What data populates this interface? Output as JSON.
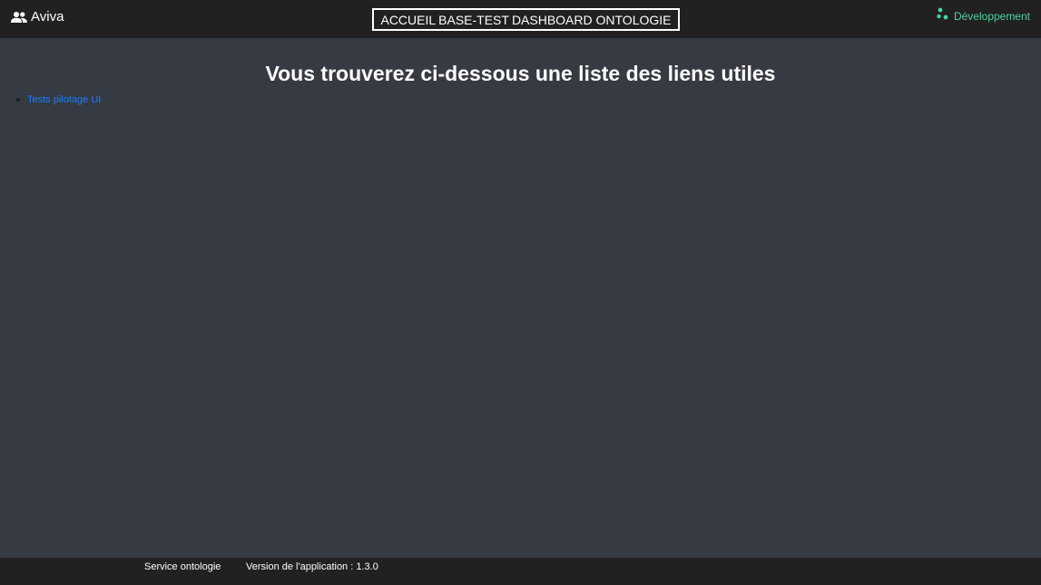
{
  "header": {
    "brand": "Aviva",
    "brand_icon": "users-icon",
    "nav": [
      {
        "label": "ACCUEIL"
      },
      {
        "label": "BASE-TEST"
      },
      {
        "label": "DASHBOARD ONTOLOGIE"
      }
    ],
    "environment": "Développement",
    "environment_icon": "cluster-dots-icon",
    "environment_color": "#4fd1a1"
  },
  "main": {
    "title": "Vous trouverez ci-dessous une liste des liens utiles",
    "links": [
      {
        "label": "Tests pilotage UI"
      }
    ],
    "link_color": "#1a7dff"
  },
  "footer": {
    "service": "Service ontologie",
    "version": "Version de l'application : 1.3.0"
  },
  "colors": {
    "background": "#363a42",
    "bar": "#212121"
  }
}
